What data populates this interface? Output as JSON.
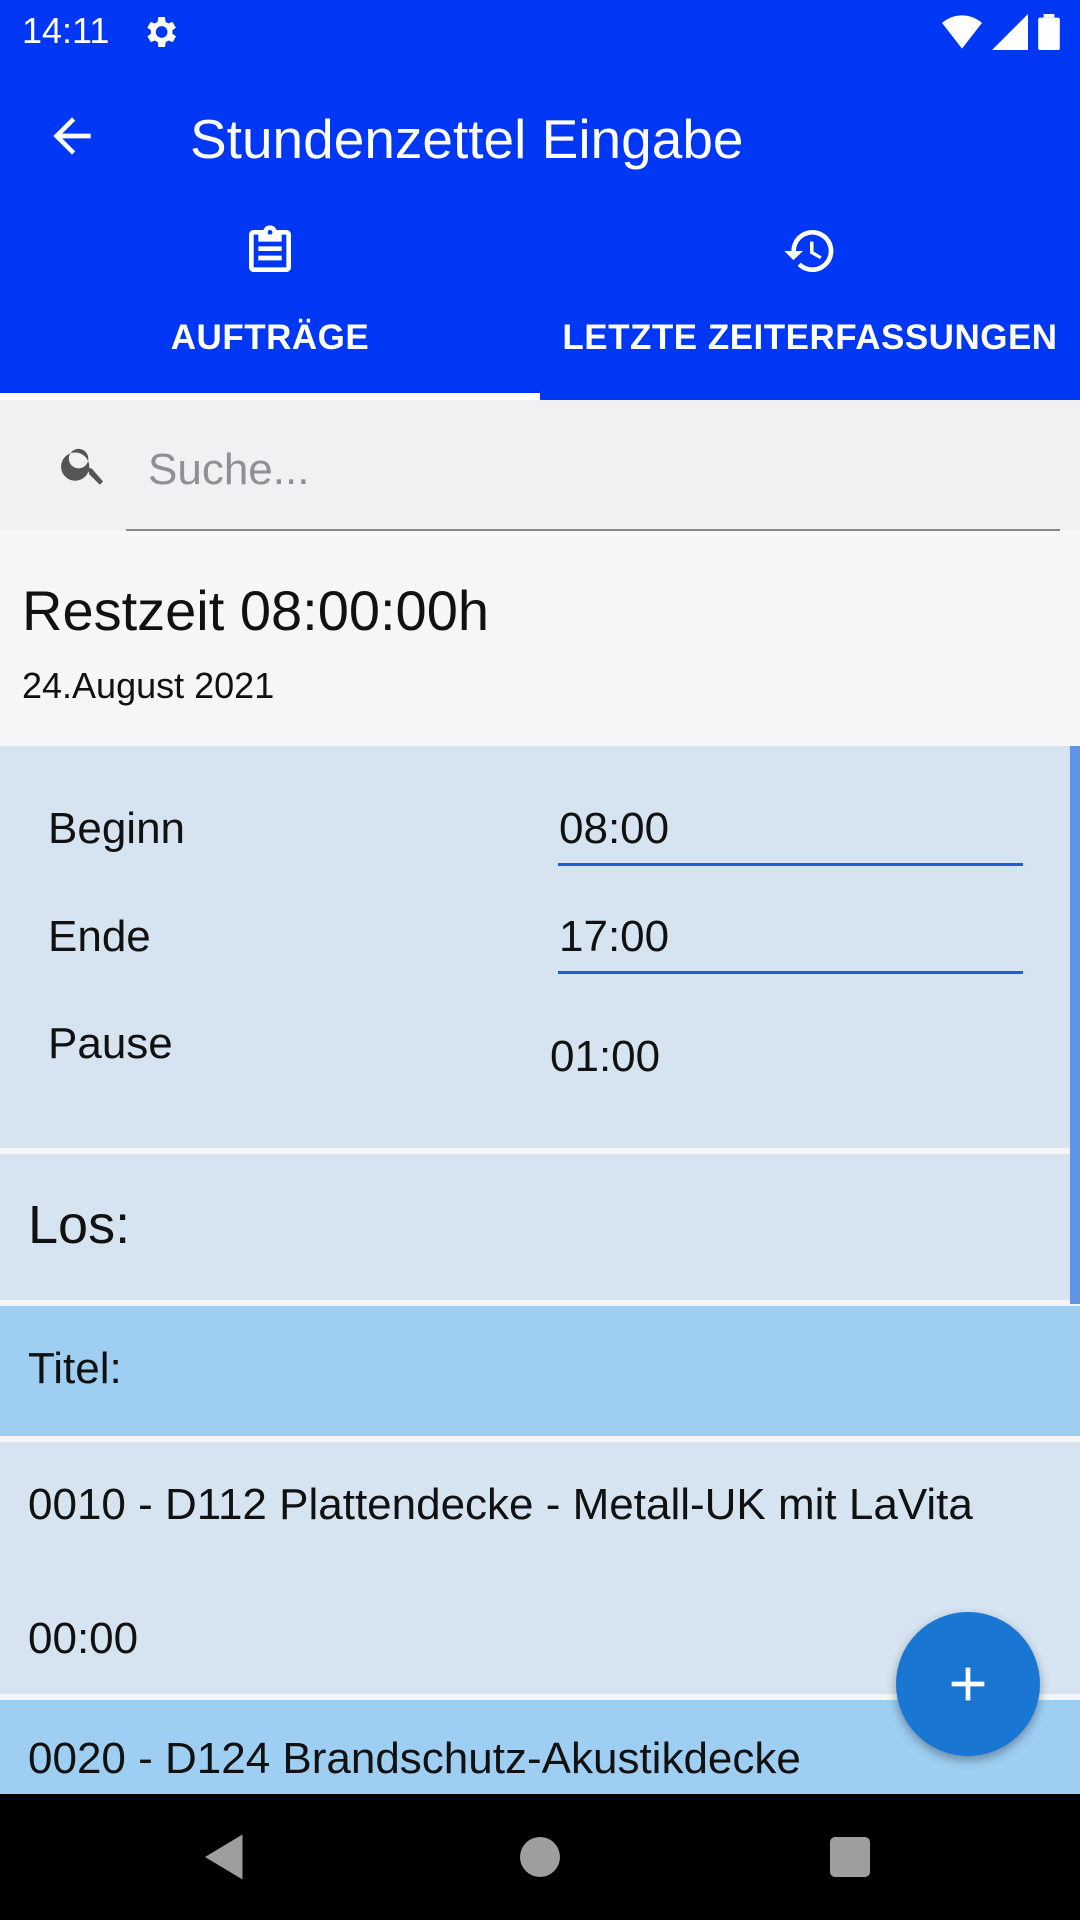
{
  "status_bar": {
    "time": "14:11"
  },
  "app_bar": {
    "title": "Stundenzettel Eingabe",
    "tabs": [
      {
        "label": "AUFTRÄGE",
        "icon": "clipboard-icon",
        "selected": true
      },
      {
        "label": "LETZTE ZEITERFASSUNGEN",
        "icon": "history-icon",
        "selected": false
      }
    ]
  },
  "search": {
    "placeholder": "Suche..."
  },
  "summary": {
    "rest": "Restzeit 08:00:00h",
    "date": "24.August 2021"
  },
  "times": {
    "begin_label": "Beginn",
    "begin_value": "08:00",
    "end_label": "Ende",
    "end_value": "17:00",
    "pause_label": "Pause",
    "pause_value": "01:00"
  },
  "los_label": "Los:",
  "titel_label": "Titel:",
  "items": [
    {
      "name": "0010 - D112 Plattendecke - Metall-UK mit LaVita",
      "duration": "00:00"
    },
    {
      "name": "0020 - D124 Brandschutz-Akustikdecke"
    }
  ],
  "colors": {
    "primary": "#0037f5",
    "fab": "#1976d2",
    "section": "#d6e4f2",
    "highlight": "#9ecff3"
  }
}
